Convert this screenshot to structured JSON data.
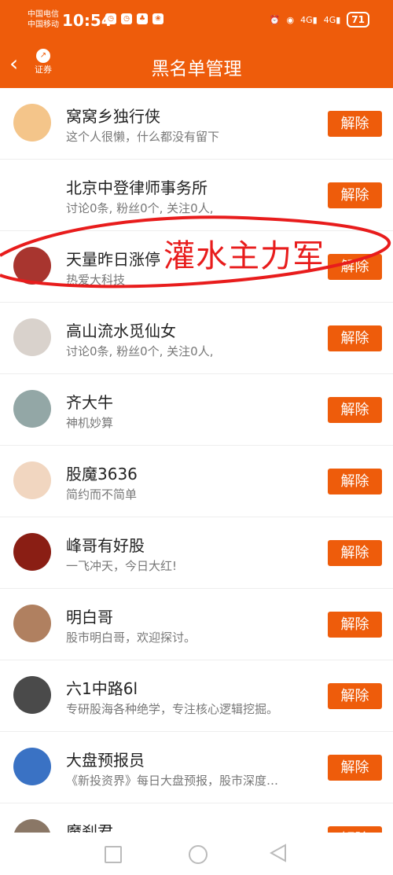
{
  "status": {
    "carrier1": "中国电信",
    "carrier2": "中国移动",
    "time": "10:54",
    "net1": "4G",
    "net2": "4G",
    "battery": "71"
  },
  "header": {
    "back_icon": "chevron-left-icon",
    "logo_text": "证券",
    "title": "黑名单管理"
  },
  "rows": [
    {
      "name": "窝窝乡独行侠",
      "desc": "这个人很懒，什么都没有留下",
      "button": "解除",
      "avatar_color": "#f4c58a"
    },
    {
      "name": "北京中登律师事务所",
      "desc": "讨论0条, 粉丝0个, 关注0人,",
      "button": "解除",
      "avatar_color": "#ffffff"
    },
    {
      "name": "天量昨日涨停",
      "desc": "热爱大科技",
      "button": "解除",
      "avatar_color": "#a8352f"
    },
    {
      "name": "高山流水觅仙女",
      "desc": "讨论0条, 粉丝0个, 关注0人,",
      "button": "解除",
      "avatar_color": "#d9d2cc"
    },
    {
      "name": "齐大牛",
      "desc": "神机妙算",
      "button": "解除",
      "avatar_color": "#93a7a6"
    },
    {
      "name": "股魔3636",
      "desc": "简约而不简单",
      "button": "解除",
      "avatar_color": "#f1d6c0"
    },
    {
      "name": "峰哥有好股",
      "desc": "一飞冲天，今日大红!",
      "button": "解除",
      "avatar_color": "#8a1e14"
    },
    {
      "name": "明白哥",
      "desc": "股市明白哥，欢迎探讨。",
      "button": "解除",
      "avatar_color": "#b08060"
    },
    {
      "name": "六1中路6l",
      "desc": "专研股海各种绝学，专注核心逻辑挖掘。",
      "button": "解除",
      "avatar_color": "#4a4a4a"
    },
    {
      "name": "大盘预报员",
      "desc": "《新投资界》每日大盘预报，股市深度…",
      "button": "解除",
      "avatar_color": "#3a72c4"
    },
    {
      "name": "魔刹君",
      "desc": "",
      "button": "解除",
      "avatar_color": "#8a7766"
    }
  ],
  "annotation": {
    "text": "灌水主力军",
    "color": "#e81c1c"
  },
  "accent": "#ee5c0b"
}
